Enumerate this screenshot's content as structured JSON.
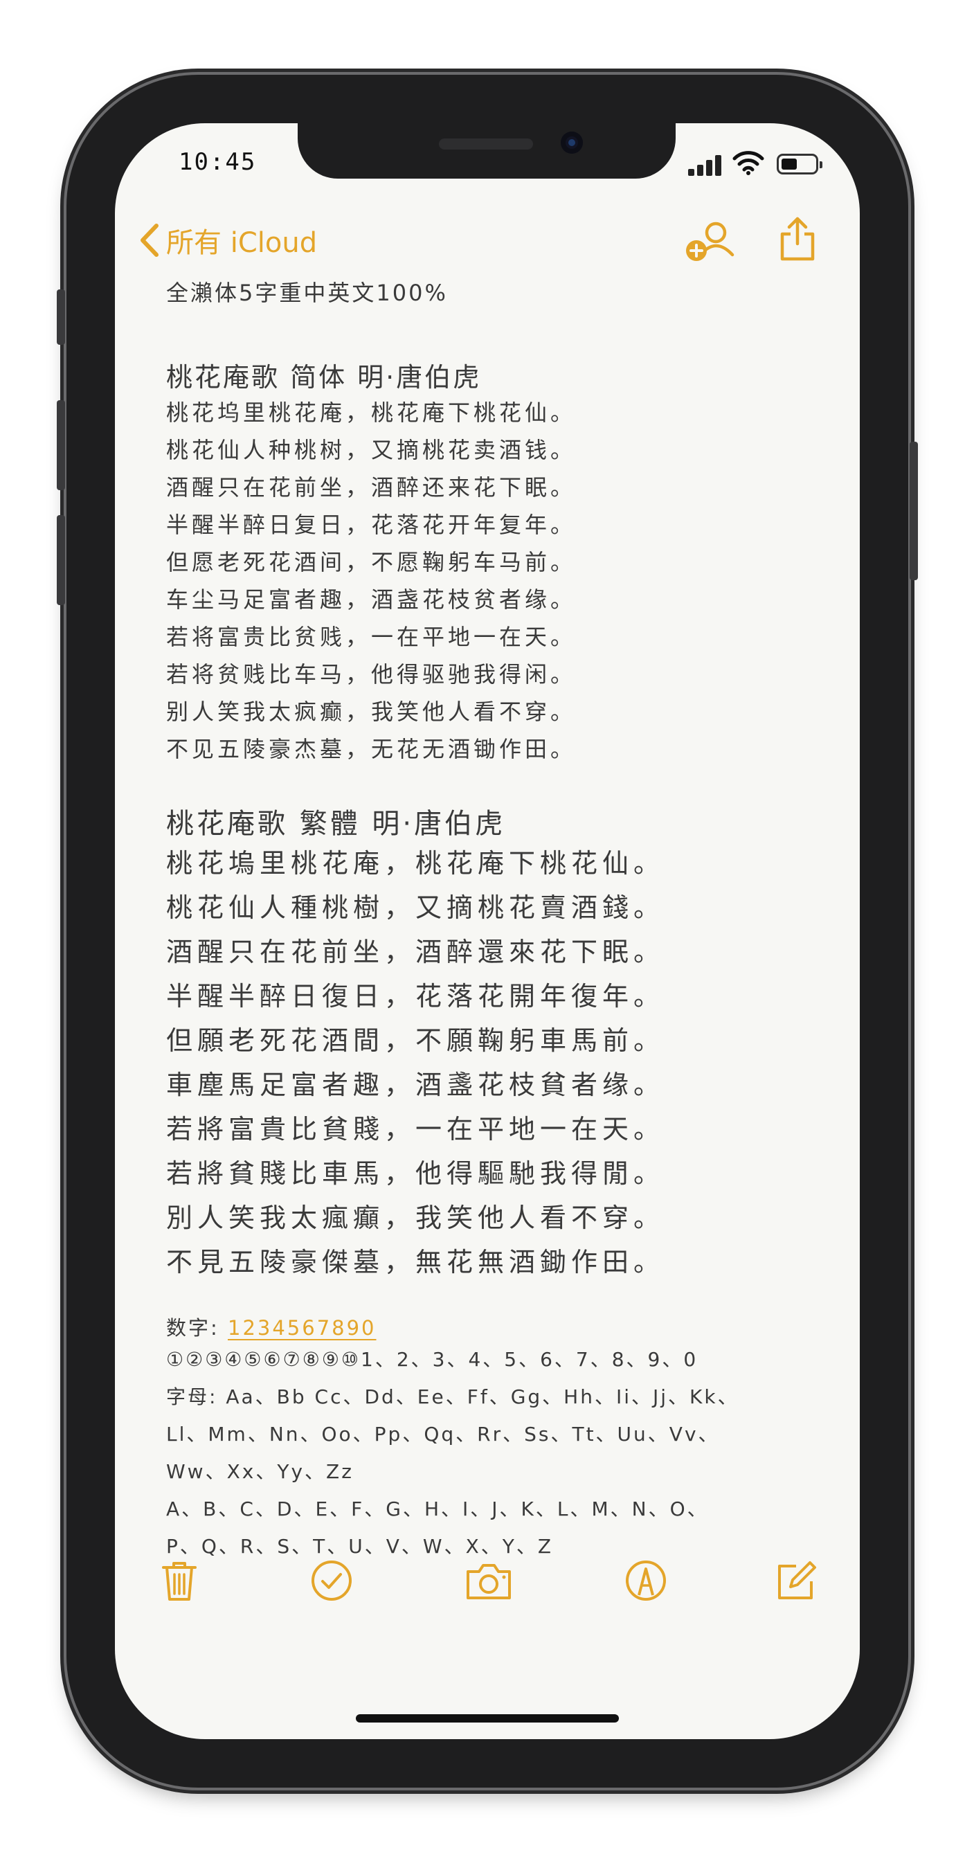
{
  "status": {
    "time": "10:45"
  },
  "nav": {
    "back_label": "所有 iCloud"
  },
  "note": {
    "meta": "全瀨体5字重中英文100%",
    "simplified": {
      "title": "桃花庵歌 简体  明·唐伯虎",
      "lines": [
        "桃花坞里桃花庵，桃花庵下桃花仙。",
        "桃花仙人种桃树，又摘桃花卖酒钱。",
        "酒醒只在花前坐，酒醉还来花下眠。",
        "半醒半醉日复日，花落花开年复年。",
        "但愿老死花酒间，不愿鞠躬车马前。",
        "车尘马足富者趣，酒盏花枝贫者缘。",
        "若将富贵比贫贱，一在平地一在天。",
        "若将贫贱比车马，他得驱驰我得闲。",
        "别人笑我太疯癫，我笑他人看不穿。",
        "不见五陵豪杰墓，无花无酒锄作田。"
      ]
    },
    "traditional": {
      "title": "桃花庵歌 繁體   明·唐伯虎",
      "lines": [
        "桃花塢里桃花庵，桃花庵下桃花仙。",
        "桃花仙人種桃樹，又摘桃花賣酒錢。",
        "酒醒只在花前坐，酒醉還來花下眠。",
        "半醒半醉日復日，花落花開年復年。",
        "但願老死花酒間，不願鞠躬車馬前。",
        "車塵馬足富者趣，酒盞花枝貧者缘。",
        "若將富貴比貧賤，一在平地一在天。",
        "若將貧賤比車馬，他得驅馳我得閒。",
        "別人笑我太瘋癲，我笑他人看不穿。",
        "不見五陵豪傑墓，無花無酒鋤作田。"
      ]
    },
    "digits_label": "数字: ",
    "digits_value": "1234567890",
    "circled": "①②③④⑤⑥⑦⑧⑨⑩1、2、3、4、5、6、7、8、9、0",
    "alphabet": [
      "字母: Aa、Bb Cc、Dd、Ee、Ff、Gg、Hh、Ii、Jj、Kk、",
      "Ll、Mm、Nn、Oo、Pp、Qq、Rr、Ss、Tt、Uu、Vv、",
      "Ww、Xx、Yy、Zz",
      "A、B、C、D、E、F、G、H、I、J、K、L、M、N、O、",
      "P、Q、R、S、T、U、V、W、X、Y、Z"
    ]
  },
  "colors": {
    "accent": "#e4a52a",
    "text": "#3a3a3a",
    "paper": "#f7f7f4"
  },
  "icons": {
    "back": "chevron-left-icon",
    "share_person": "add-person-icon",
    "share": "share-icon",
    "toolbar": [
      "trash-icon",
      "checklist-icon",
      "camera-icon",
      "markup-pen-icon",
      "compose-icon"
    ]
  }
}
